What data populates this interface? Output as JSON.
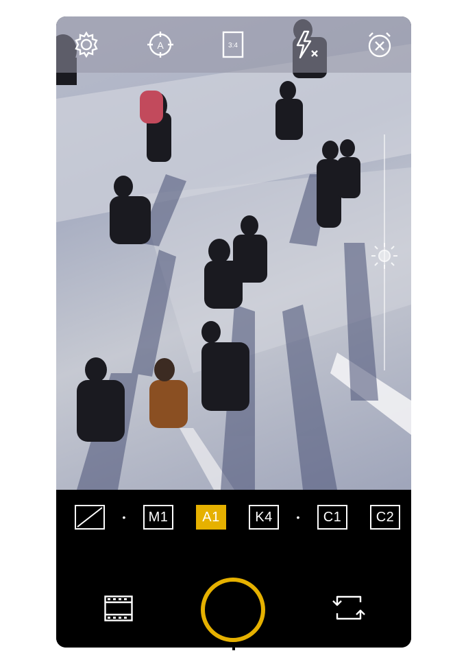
{
  "topbar": {
    "icons": [
      {
        "name": "settings-gear-icon"
      },
      {
        "name": "focus-auto-icon",
        "label": "A"
      },
      {
        "name": "aspect-ratio-icon",
        "label": "3:4"
      },
      {
        "name": "flash-off-icon"
      },
      {
        "name": "timer-off-icon"
      }
    ]
  },
  "exposure": {
    "icon": "sun-icon"
  },
  "modes": {
    "items": [
      {
        "label": "",
        "icon": "no-filter-icon"
      },
      {
        "label": "M1"
      },
      {
        "label": "A1",
        "active": true
      },
      {
        "label": "K4"
      },
      {
        "label": "C1"
      },
      {
        "label": "C2"
      }
    ],
    "separator": "•"
  },
  "bottom": {
    "left_icon": "film-strip-icon",
    "shutter_icon": "shutter-button",
    "right_icon": "switch-camera-icon"
  },
  "colors": {
    "accent": "#e6b100",
    "bar": "#000000"
  }
}
